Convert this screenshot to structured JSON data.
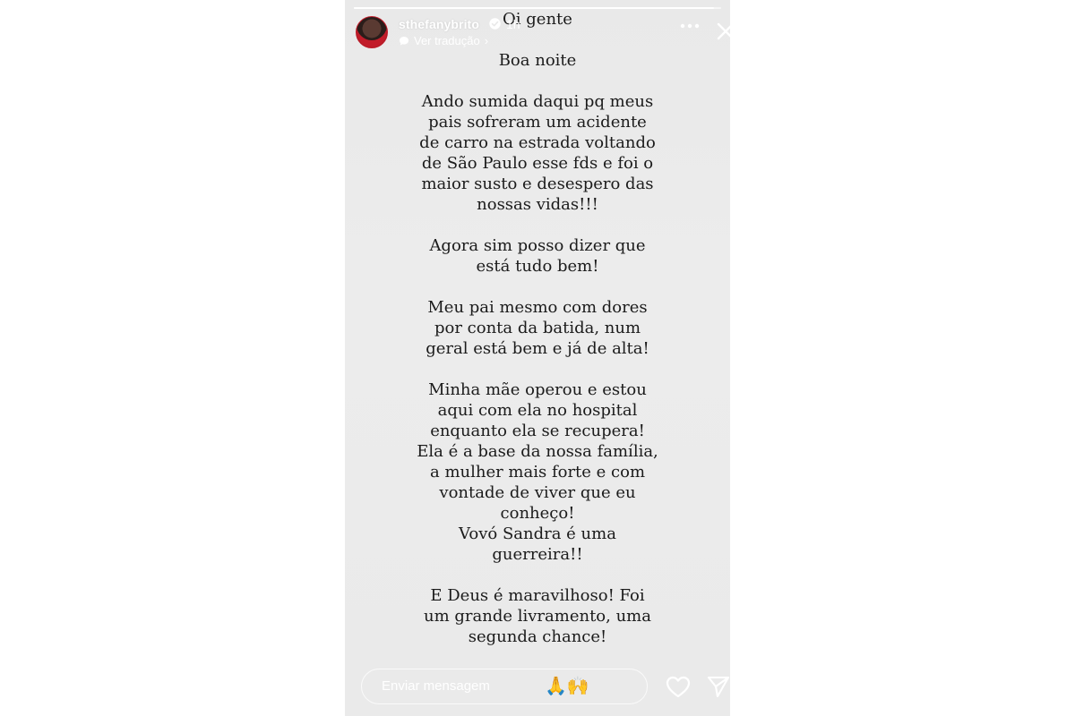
{
  "story": {
    "username": "sthefanybrito",
    "time": "1h",
    "translate_label": "Ver tradução",
    "progress": 0.98,
    "paragraphs": [
      "Oi gente",
      "Boa noite",
      "Ando sumida daqui pq meus\npais sofreram um acidente\nde carro na estrada voltando\nde São Paulo esse fds e foi o\nmaior susto e desespero das\nnossas vidas!!!",
      "Agora sim posso dizer que\nestá tudo bem!",
      "Meu pai mesmo com dores\npor conta da batida, num\ngeral está bem e já de alta!",
      "Minha mãe operou e estou\naqui com ela no hospital\nenquanto ela se recupera!\nEla é a base da nossa família,\na mulher mais forte e com\nvontade de viver que eu\nconheço!\nVovó Sandra é uma\nguerreira!!",
      "E Deus é maravilhoso! Foi\num grande livramento, uma\nsegunda chance!"
    ],
    "reply_placeholder": "Enviar mensagem",
    "reply_emoji": "🙏🙌"
  },
  "icons": {
    "verified": "verified-badge-icon",
    "translate": "translate-icon",
    "more": "more-options-icon",
    "close": "close-icon",
    "heart": "heart-icon",
    "send": "send-icon"
  },
  "colors": {
    "story_background": "#ebebeb",
    "text": "#1b1b1b",
    "overlay_text": "#ffffff",
    "avatar_accent": "#c21c2a"
  }
}
